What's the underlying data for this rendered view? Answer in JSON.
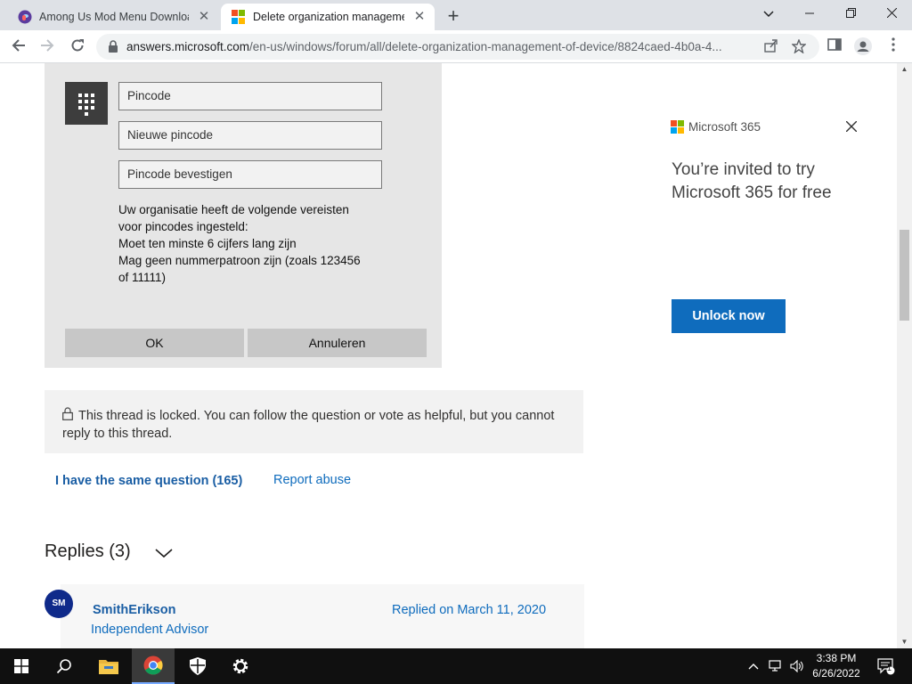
{
  "browser": {
    "tabs": [
      {
        "title": "Among Us Mod Menu Download",
        "active": false
      },
      {
        "title": "Delete organization managemen",
        "active": true
      }
    ],
    "url_host": "answers.microsoft.com",
    "url_path": "/en-us/windows/forum/all/delete-organization-management-of-device/8824caed-4b0a-4..."
  },
  "dialog": {
    "pin_placeholder": "Pincode",
    "new_pin_placeholder": "Nieuwe pincode",
    "confirm_pin_placeholder": "Pincode bevestigen",
    "requirements": [
      "Uw organisatie heeft de volgende vereisten",
      "voor pincodes ingesteld:",
      "Moet ten minste 6 cijfers lang zijn",
      "Mag geen nummerpatroon zijn (zoals 123456",
      "of 11111)"
    ],
    "ok_label": "OK",
    "cancel_label": "Annuleren"
  },
  "thread": {
    "locked_text": "This thread is locked. You can follow the question or vote as helpful, but you cannot reply to this thread.",
    "same_question_label": "I have the same question (165)",
    "report_abuse_label": "Report abuse",
    "replies_heading": "Replies (3)"
  },
  "reply": {
    "avatar_initials": "SM",
    "author": "SmithErikson",
    "role": "Independent Advisor",
    "replied_on": "Replied on March 11, 2020"
  },
  "ad": {
    "brand": "Microsoft 365",
    "headline": "You’re invited to try Microsoft 365 for free",
    "cta": "Unlock now"
  },
  "taskbar": {
    "time": "3:38 PM",
    "date": "6/26/2022",
    "notification_count": "1"
  },
  "colors": {
    "link": "#0f6cbd",
    "cta_bg": "#0f6cbd",
    "dialog_bg": "#e6e6e6",
    "ms_red": "#f25022",
    "ms_green": "#7fba00",
    "ms_blue": "#00a4ef",
    "ms_yellow": "#ffb900"
  },
  "icons": [
    "back-arrow-icon",
    "forward-arrow-icon",
    "reload-icon",
    "lock-icon",
    "share-icon",
    "star-icon",
    "sidebar-icon",
    "profile-icon",
    "menu-dots-icon",
    "keypad-icon",
    "close-icon",
    "chevron-down-icon",
    "windows-start-icon",
    "search-icon",
    "file-explorer-icon",
    "chrome-icon",
    "security-icon",
    "settings-icon"
  ]
}
